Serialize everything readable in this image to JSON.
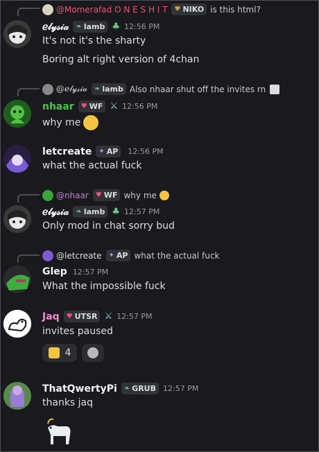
{
  "messages": [
    {
      "reply": {
        "name": "@Momerafad O N E S H I T",
        "tag": "NIKO",
        "text": "is this html?"
      },
      "author": "ℯ𝓁𝓎𝓈𝒾𝒶",
      "tag": "lamb",
      "time": "12:56 PM",
      "lines": [
        "It's not it's the sharty",
        "Boring alt right version of 4chan"
      ]
    },
    {
      "reply": {
        "name": "@ℯ𝓁𝓎𝓈𝒾𝒶",
        "tag": "lamb",
        "text": "Also nhaar shut off the invites rn"
      },
      "author": "nhaar",
      "tag": "WF",
      "time": "12:56 PM",
      "lines": [
        "why me"
      ]
    },
    {
      "author": "letcreate",
      "tag": "AP",
      "time": "12:56 PM",
      "lines": [
        "what the actual fuck"
      ]
    },
    {
      "reply": {
        "name": "@nhaar",
        "tag": "WF",
        "text": "why me"
      },
      "author": "ℯ𝓁𝓎𝓈𝒾𝒶",
      "tag": "lamb",
      "time": "12:57 PM",
      "lines": [
        "Only mod in chat sorry bud"
      ]
    },
    {
      "reply": {
        "name": "@letcreate",
        "tag": "AP",
        "text": "what the actual fuck"
      },
      "author": "Glep",
      "time": "12:57 PM",
      "lines": [
        "What the impossible fuck"
      ]
    },
    {
      "author": "Jaq",
      "tag": "UTSR",
      "time": "12:57 PM",
      "lines": [
        "invites paused"
      ],
      "reaction_count": "4"
    },
    {
      "author": "ThatQwertyPi",
      "tag": "GRUB",
      "time": "12:57 PM",
      "lines": [
        "thanks jaq"
      ]
    }
  ],
  "colors": {
    "nhaar": "#4ec14e",
    "jaq": "#f08cc8",
    "reply_momerafad": "#f0506e",
    "reply_nhaar": "#c77bd6"
  }
}
